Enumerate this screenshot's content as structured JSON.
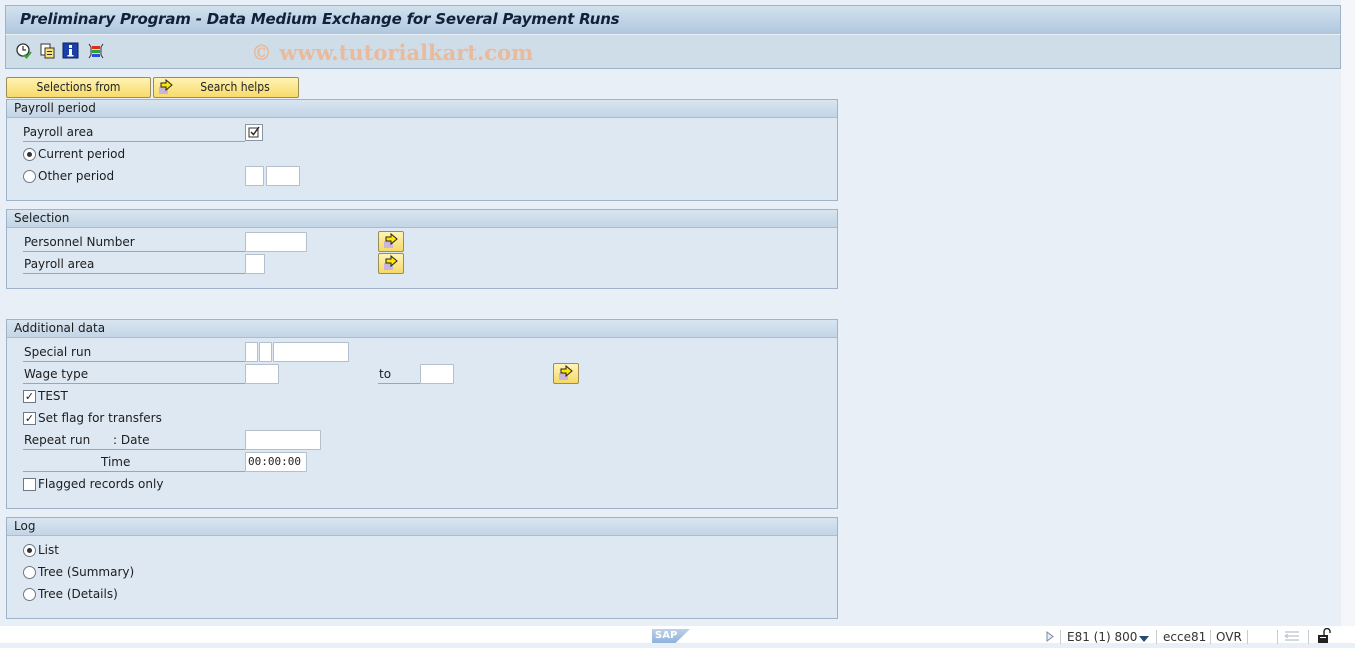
{
  "window": {
    "title": "Preliminary Program - Data Medium Exchange for Several Payment Runs",
    "watermark": "© www.tutorialkart.com"
  },
  "toolbar": {
    "icons": [
      "execute-icon",
      "copy-variant-icon",
      "info-icon",
      "selection-options-icon"
    ]
  },
  "buttons": {
    "selections_from": "Selections from",
    "search_helps": "Search helps"
  },
  "payroll_period": {
    "title": "Payroll period",
    "payroll_area_label": "Payroll area",
    "payroll_area_checked": true,
    "current_period_label": "Current period",
    "current_period_selected": true,
    "other_period_label": "Other period",
    "other_period_selected": false,
    "other_period_value1": "",
    "other_period_value2": ""
  },
  "selection": {
    "title": "Selection",
    "personnel_number_label": "Personnel Number",
    "personnel_number_value": "",
    "payroll_area_label": "Payroll area",
    "payroll_area_value": ""
  },
  "additional_data": {
    "title": "Additional data",
    "special_run_label": "Special run",
    "special_run_values": [
      "",
      "",
      ""
    ],
    "wage_type_label": "Wage type",
    "wage_type_from": "",
    "to_label": "to",
    "wage_type_to": "",
    "test_label": "TEST",
    "test_checked": true,
    "set_flag_label": "Set flag for transfers",
    "set_flag_checked": true,
    "repeat_run_label": "Repeat run",
    "date_label": ": Date",
    "date_value": "",
    "time_label": "Time",
    "time_value": "00:00:00",
    "flagged_only_label": "Flagged records only",
    "flagged_only_checked": false
  },
  "log": {
    "title": "Log",
    "options": [
      {
        "label": "List",
        "selected": true
      },
      {
        "label": "Tree (Summary)",
        "selected": false
      },
      {
        "label": "Tree (Details)",
        "selected": false
      }
    ]
  },
  "status_bar": {
    "logo": "SAP",
    "system": "E81 (1) 800",
    "server": "ecce81",
    "mode": "OVR"
  }
}
